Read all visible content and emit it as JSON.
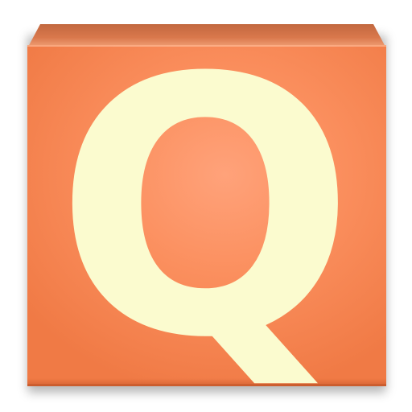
{
  "app_icon": {
    "letter": "Q",
    "tile_color": "#fb8f5e",
    "letter_color": "#fbfbcf"
  }
}
